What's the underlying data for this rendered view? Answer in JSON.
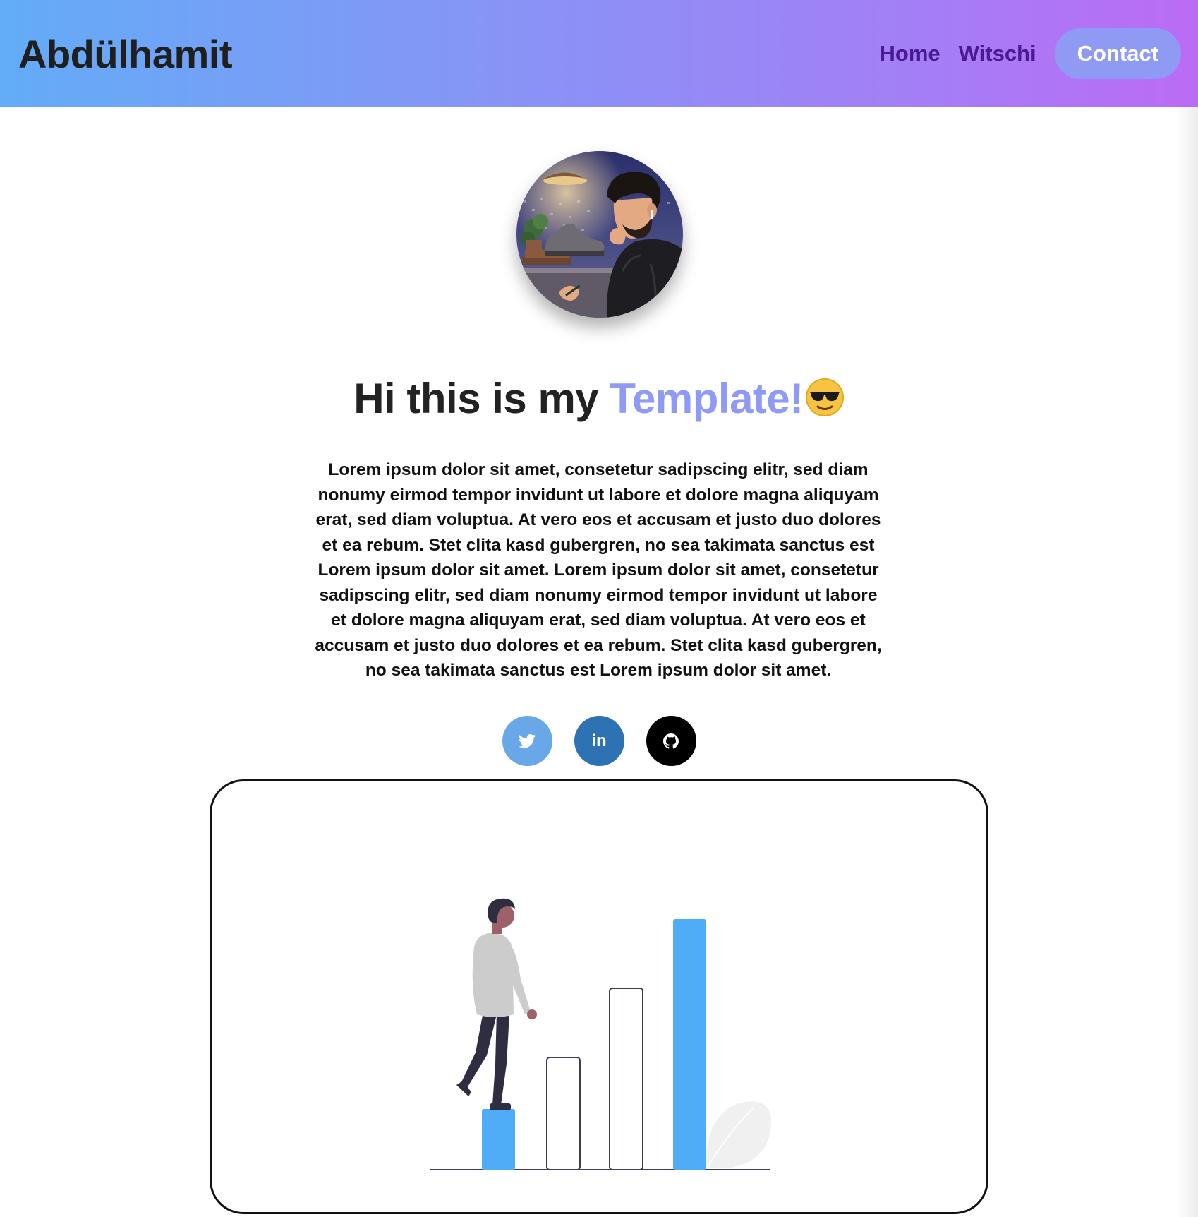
{
  "header": {
    "brand": "Abdülhamit",
    "nav": {
      "home_label": "Home",
      "witschi_label": "Witschi",
      "contact_label": "Contact"
    }
  },
  "hero": {
    "headline_prefix": "Hi this is my ",
    "headline_accent": "Template!",
    "headline_emoji": "smiling-face-with-sunglasses",
    "paragraph": "Lorem ipsum dolor sit amet, consetetur sadipscing elitr, sed diam nonumy eirmod tempor invidunt ut labore et dolore magna aliquyam erat, sed diam voluptua. At vero eos et accusam et justo duo dolores et ea rebum. Stet clita kasd gubergren, no sea takimata sanctus est Lorem ipsum dolor sit amet. Lorem ipsum dolor sit amet, consetetur sadipscing elitr, sed diam nonumy eirmod tempor invidunt ut labore et dolore magna aliquyam erat, sed diam voluptua. At vero eos et accusam et justo duo dolores et ea rebum. Stet clita kasd gubergren, no sea takimata sanctus est Lorem ipsum dolor sit amet."
  },
  "social": {
    "items": [
      {
        "icon": "twitter-icon",
        "color": "#69a8e8"
      },
      {
        "icon": "linkedin-icon",
        "color": "#2d72b2"
      },
      {
        "icon": "github-icon",
        "color": "#000000"
      }
    ]
  },
  "colors": {
    "header_gradient_start": "#63acf7",
    "header_gradient_end": "#bb6bf5",
    "accent": "#8f9af5",
    "nav_text": "#4a1a92",
    "illustration_blue": "#4fadf7"
  }
}
